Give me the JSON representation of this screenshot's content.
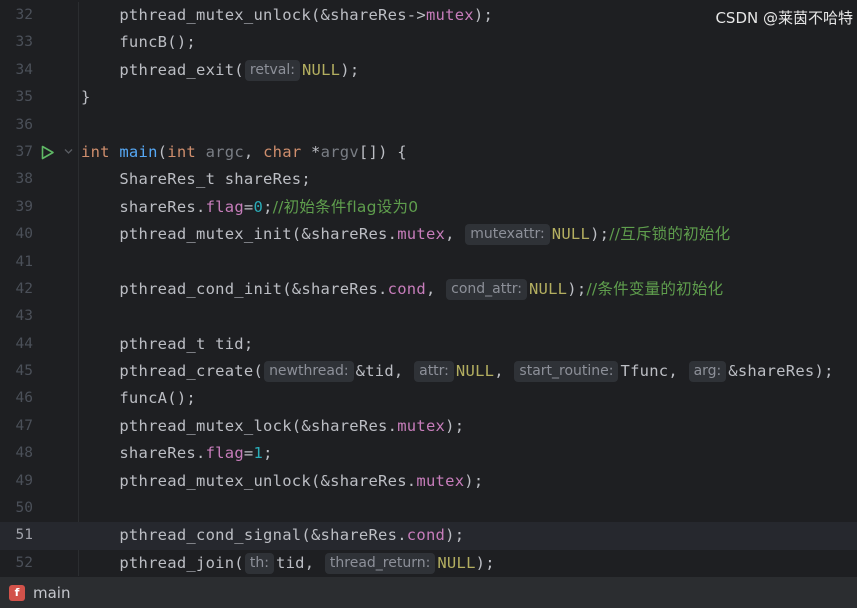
{
  "editor": {
    "lines": [
      {
        "num": "32",
        "tokens": [
          [
            "",
            "    "
          ],
          [
            "",
            "pthread_mutex_unlock(&shareRes->"
          ],
          [
            "fld",
            "mutex"
          ],
          [
            "",
            ");"
          ]
        ]
      },
      {
        "num": "33",
        "tokens": [
          [
            "",
            "    "
          ],
          [
            "",
            "funcB();"
          ]
        ]
      },
      {
        "num": "34",
        "tokens": [
          [
            "",
            "    "
          ],
          [
            "",
            "pthread_exit("
          ],
          [
            "hint",
            "retval:"
          ],
          [
            "mac",
            "NULL"
          ],
          [
            "",
            ");"
          ]
        ]
      },
      {
        "num": "35",
        "tokens": [
          [
            "",
            "}"
          ]
        ]
      },
      {
        "num": "36",
        "tokens": []
      },
      {
        "num": "37",
        "run": true,
        "fold": true,
        "tokens": [
          [
            "kw",
            "int "
          ],
          [
            "fn",
            "main"
          ],
          [
            "",
            "("
          ],
          [
            "kw",
            "int "
          ],
          [
            "prm",
            "argc"
          ],
          [
            "",
            ", "
          ],
          [
            "kw",
            "char "
          ],
          [
            "",
            "*"
          ],
          [
            "prm",
            "argv"
          ],
          [
            "",
            "[]) {"
          ]
        ]
      },
      {
        "num": "38",
        "tokens": [
          [
            "",
            "    "
          ],
          [
            "",
            "ShareRes_t shareRes;"
          ]
        ]
      },
      {
        "num": "39",
        "tokens": [
          [
            "",
            "    "
          ],
          [
            "",
            "shareRes."
          ],
          [
            "fld",
            "flag"
          ],
          [
            "",
            "="
          ],
          [
            "num",
            "0"
          ],
          [
            "",
            ";"
          ],
          [
            "cmt",
            "//初始条件flag设为0"
          ]
        ]
      },
      {
        "num": "40",
        "tokens": [
          [
            "",
            "    "
          ],
          [
            "",
            "pthread_mutex_init(&shareRes."
          ],
          [
            "fld",
            "mutex"
          ],
          [
            "",
            ", "
          ],
          [
            "hint",
            "mutexattr:"
          ],
          [
            "mac",
            "NULL"
          ],
          [
            "",
            ");"
          ],
          [
            "cmt",
            "//互斥锁的初始化"
          ]
        ]
      },
      {
        "num": "41",
        "tokens": []
      },
      {
        "num": "42",
        "tokens": [
          [
            "",
            "    "
          ],
          [
            "",
            "pthread_cond_init(&shareRes."
          ],
          [
            "fld",
            "cond"
          ],
          [
            "",
            ", "
          ],
          [
            "hint",
            "cond_attr:"
          ],
          [
            "mac",
            "NULL"
          ],
          [
            "",
            ");"
          ],
          [
            "cmt",
            "//条件变量的初始化"
          ]
        ]
      },
      {
        "num": "43",
        "tokens": []
      },
      {
        "num": "44",
        "tokens": [
          [
            "",
            "    "
          ],
          [
            "",
            "pthread_t tid;"
          ]
        ]
      },
      {
        "num": "45",
        "tokens": [
          [
            "",
            "    "
          ],
          [
            "",
            "pthread_create("
          ],
          [
            "hint",
            "newthread:"
          ],
          [
            "",
            "&tid, "
          ],
          [
            "hint",
            "attr:"
          ],
          [
            "mac",
            "NULL"
          ],
          [
            "",
            ", "
          ],
          [
            "hint",
            "start_routine:"
          ],
          [
            "",
            "Tfunc, "
          ],
          [
            "hint",
            "arg:"
          ],
          [
            "",
            "&shareRes);"
          ]
        ]
      },
      {
        "num": "46",
        "tokens": [
          [
            "",
            "    "
          ],
          [
            "",
            "funcA();"
          ]
        ]
      },
      {
        "num": "47",
        "tokens": [
          [
            "",
            "    "
          ],
          [
            "",
            "pthread_mutex_lock(&shareRes."
          ],
          [
            "fld",
            "mutex"
          ],
          [
            "",
            ");"
          ]
        ]
      },
      {
        "num": "48",
        "tokens": [
          [
            "",
            "    "
          ],
          [
            "",
            "shareRes."
          ],
          [
            "fld",
            "flag"
          ],
          [
            "",
            "="
          ],
          [
            "num",
            "1"
          ],
          [
            "",
            ";"
          ]
        ]
      },
      {
        "num": "49",
        "tokens": [
          [
            "",
            "    "
          ],
          [
            "",
            "pthread_mutex_unlock(&shareRes."
          ],
          [
            "fld",
            "mutex"
          ],
          [
            "",
            ");"
          ]
        ]
      },
      {
        "num": "50",
        "tokens": []
      },
      {
        "num": "51",
        "current": true,
        "tokens": [
          [
            "",
            "    "
          ],
          [
            "",
            "pthread_cond_signal(&shareRes."
          ],
          [
            "fld",
            "cond"
          ],
          [
            "",
            ");"
          ]
        ]
      },
      {
        "num": "52",
        "tokens": [
          [
            "",
            "    "
          ],
          [
            "",
            "pthread_join("
          ],
          [
            "hint",
            "th:"
          ],
          [
            "",
            "tid, "
          ],
          [
            "hint",
            "thread_return:"
          ],
          [
            "mac",
            "NULL"
          ],
          [
            "",
            ");"
          ]
        ]
      }
    ]
  },
  "statusbar": {
    "file_icon_letter": "f",
    "file_name": "main"
  },
  "watermark": "CSDN @莱茵不哈特",
  "colors": {
    "background": "#1e1f22",
    "keyword": "#cf8e6d",
    "function": "#56a8f5",
    "field": "#c77dbb",
    "number": "#2aacb8",
    "macro": "#b3ae60",
    "comment": "#5f9e4d",
    "run_icon": "#5fb865",
    "file_icon": "#d2524a"
  },
  "icons": {
    "run": "run-gutter-icon",
    "fold": "fold-chevron-icon",
    "file": "c-file-icon"
  }
}
